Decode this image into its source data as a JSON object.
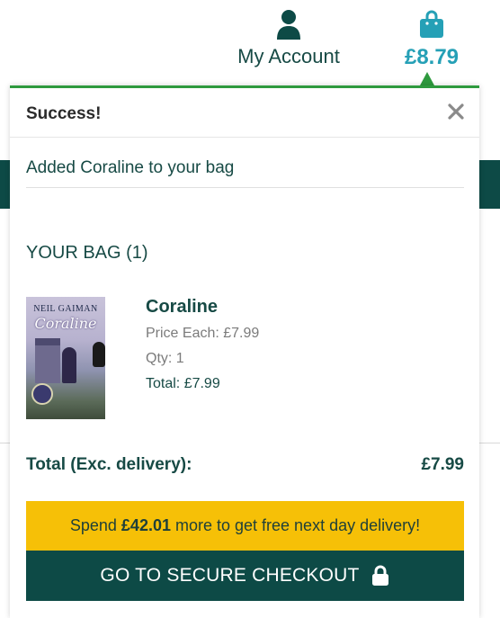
{
  "header": {
    "account_label": "My Account",
    "bag_total": "£8.79",
    "icons": {
      "account": "user-icon",
      "bag": "shopping-bag-icon"
    }
  },
  "popup": {
    "title": "Success!",
    "close_icon": "close-icon",
    "added_message": "Added Coraline to your bag",
    "bag_heading": "YOUR BAG (1)",
    "item": {
      "name": "Coraline",
      "price_each": "Price Each: £7.99",
      "qty": "Qty: 1",
      "total": "Total: £7.99",
      "cover_author": "NEIL GAIMAN",
      "cover_title": "Coraline"
    },
    "total_label": "Total (Exc. delivery):",
    "total_value": "£7.99",
    "promo": {
      "prefix": "Spend",
      "amount": "£42.01",
      "suffix": "more to get free next day delivery!"
    },
    "checkout_label": "GO TO SECURE CHECKOUT",
    "checkout_icon": "lock-icon"
  },
  "colors": {
    "primary_dark": "#0d4a46",
    "accent_teal": "#25a0b6",
    "success_green": "#2e9a3e",
    "promo_yellow": "#f6c007"
  }
}
